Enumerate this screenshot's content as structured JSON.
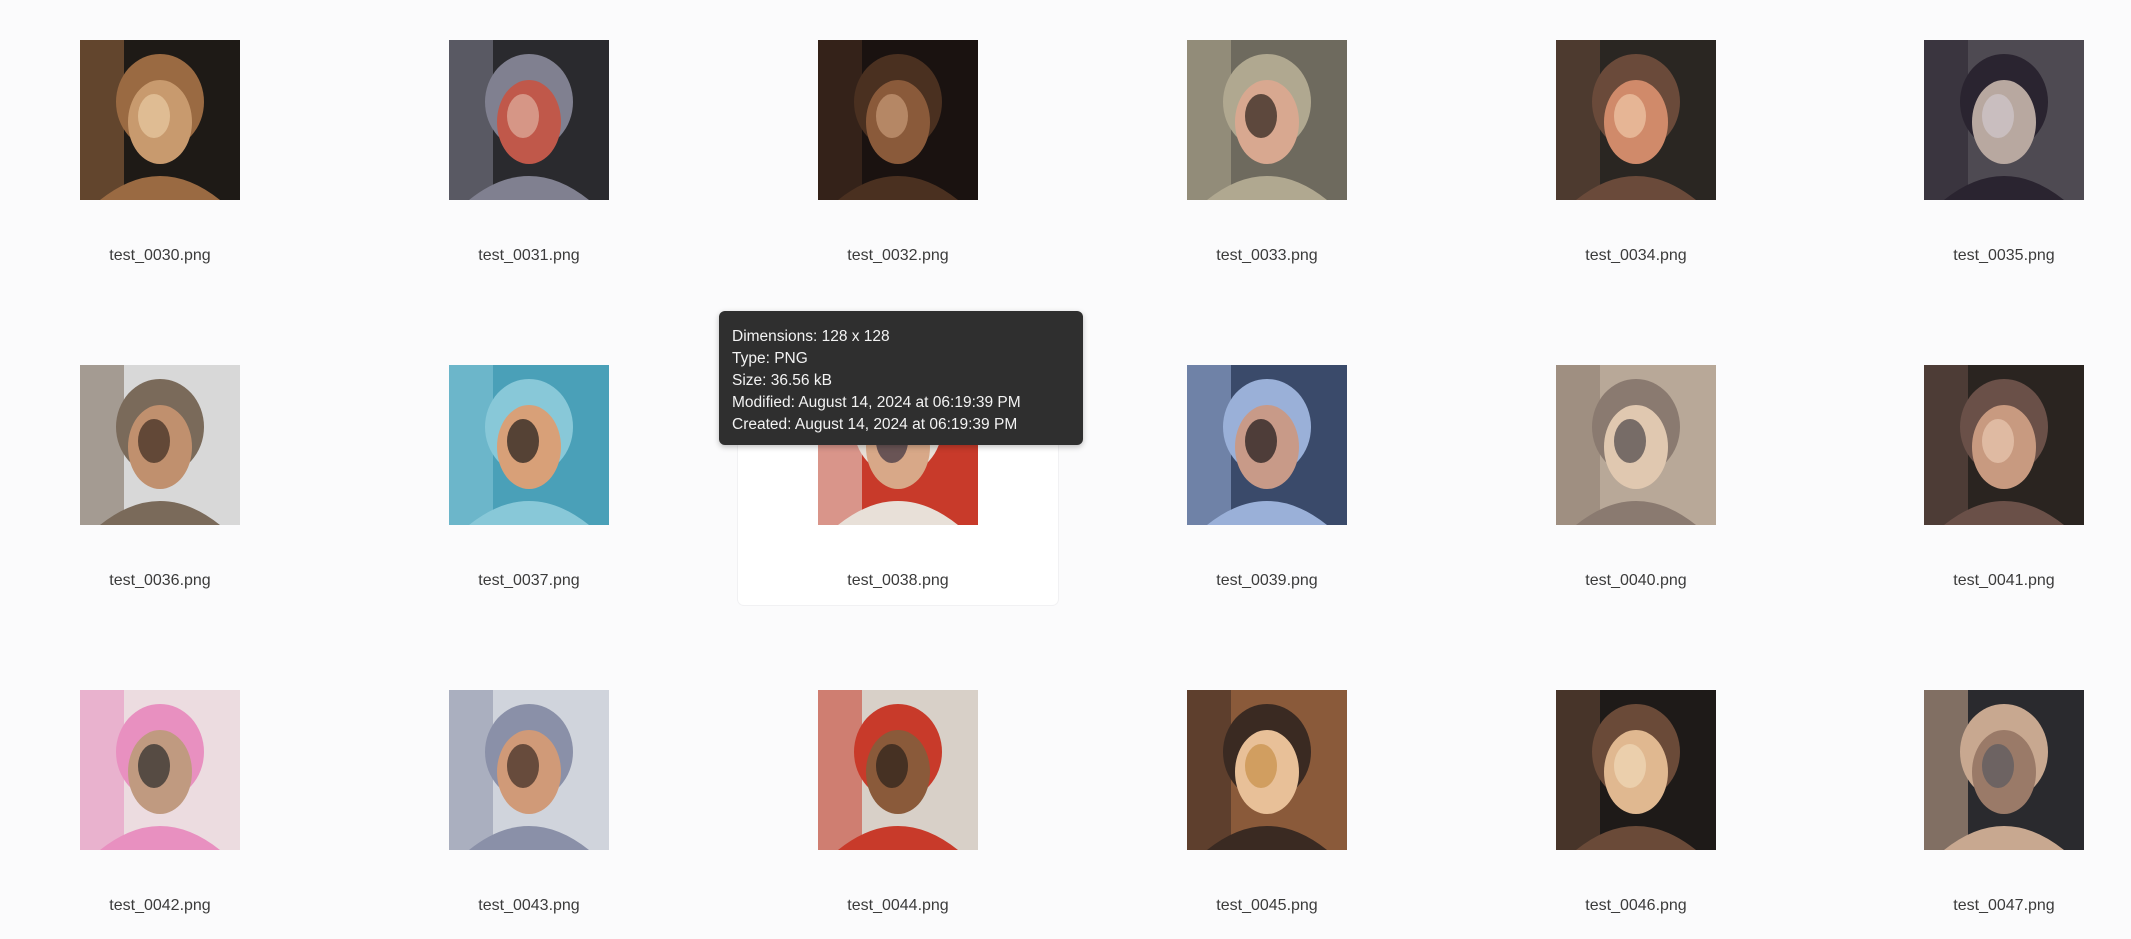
{
  "files": [
    {
      "name": "test_0030.png",
      "palette": [
        "#1e1a16",
        "#c89a6e",
        "#e8caa2",
        "#9a6a42"
      ]
    },
    {
      "name": "test_0031.png",
      "palette": [
        "#2a2a2e",
        "#c0584a",
        "#e0b0a0",
        "#808090"
      ]
    },
    {
      "name": "test_0032.png",
      "palette": [
        "#1a1210",
        "#8a5a3a",
        "#c89a78",
        "#4a3020"
      ]
    },
    {
      "name": "test_0033.png",
      "palette": [
        "#6e6a5e",
        "#d8a890",
        "#2a201a",
        "#b0a890"
      ]
    },
    {
      "name": "test_0034.png",
      "palette": [
        "#2a2622",
        "#d08a6a",
        "#f0c8a8",
        "#6a4a3a"
      ]
    },
    {
      "name": "test_0035.png",
      "palette": [
        "#4e4a52",
        "#b8a8a0",
        "#d0c8cc",
        "#2a2430"
      ]
    },
    {
      "name": "test_0036.png",
      "palette": [
        "#d8d8d8",
        "#c0906e",
        "#3a2a20",
        "#7a6a5a"
      ]
    },
    {
      "name": "test_0037.png",
      "palette": [
        "#4aa0b8",
        "#d8a078",
        "#1e1a18",
        "#88c8d8"
      ]
    },
    {
      "name": "test_0038.png",
      "palette": [
        "#c83a2a",
        "#d8a888",
        "#3a3040",
        "#e8e0d8"
      ]
    },
    {
      "name": "test_0039.png",
      "palette": [
        "#3a4a6a",
        "#c89a88",
        "#1a1618",
        "#9ab0d8"
      ]
    },
    {
      "name": "test_0040.png",
      "palette": [
        "#b8a898",
        "#e0c8b0",
        "#4a4448",
        "#8a7a70"
      ]
    },
    {
      "name": "test_0041.png",
      "palette": [
        "#2a2420",
        "#c89a80",
        "#e8c8b0",
        "#6a5048"
      ]
    },
    {
      "name": "test_0042.png",
      "palette": [
        "#ecdce0",
        "#c09a80",
        "#2a2a2a",
        "#e890c0"
      ]
    },
    {
      "name": "test_0043.png",
      "palette": [
        "#d0d4dc",
        "#d09a78",
        "#3a2a22",
        "#8a90a8"
      ]
    },
    {
      "name": "test_0044.png",
      "palette": [
        "#d8d0c8",
        "#8a5a3a",
        "#2a201a",
        "#c83a2a"
      ]
    },
    {
      "name": "test_0045.png",
      "palette": [
        "#8a5a3a",
        "#e8c098",
        "#c89048",
        "#3a2a22"
      ]
    },
    {
      "name": "test_0046.png",
      "palette": [
        "#1e1a18",
        "#e0b890",
        "#f0d8b8",
        "#6a4a38"
      ]
    },
    {
      "name": "test_0047.png",
      "palette": [
        "#2a2a2e",
        "#9a7a68",
        "#5a5a60",
        "#c8a890"
      ]
    }
  ],
  "tooltip": {
    "dimensions": "Dimensions: 128 x 128",
    "type": "Type: PNG",
    "size": "Size: 36.56 kB",
    "modified": "Modified: August 14, 2024 at 06:19:39 PM",
    "created": "Created: August 14, 2024 at 06:19:39 PM"
  }
}
